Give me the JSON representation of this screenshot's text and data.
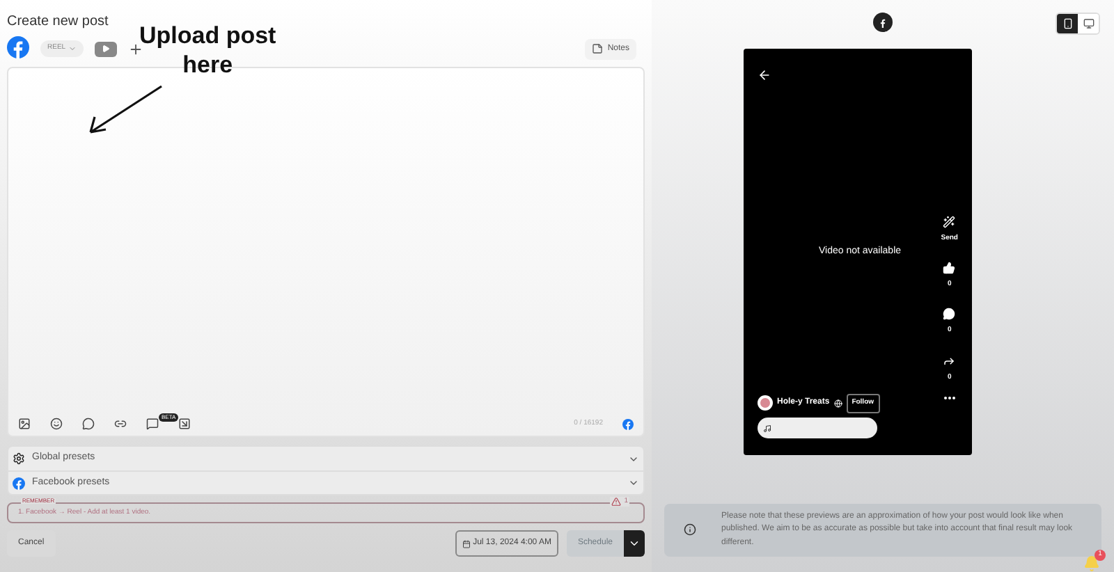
{
  "title": "Create new post",
  "composer": {
    "post_type": "REEL",
    "notes": "Notes",
    "char_count": "0 / 16192",
    "beta": "BETA"
  },
  "annotation": {
    "lines": [
      "Upload post",
      "here"
    ]
  },
  "presets": [
    {
      "kind": "global",
      "label": "Global presets"
    },
    {
      "kind": "facebook",
      "label": "Facebook presets"
    }
  ],
  "reminder": {
    "label": "REMEMBER",
    "message": "1. Facebook → Reel - Add at least 1 video.",
    "count": "1"
  },
  "footer": {
    "cancel": "Cancel",
    "date": "Jul 13, 2024 4:00 AM",
    "schedule": "Schedule"
  },
  "preview": {
    "devices": [
      {
        "kind": "mobile",
        "selected": true
      },
      {
        "kind": "desktop",
        "selected": false
      }
    ],
    "video_message": "Video not available",
    "send": "Send",
    "likes": "0",
    "comments": "0",
    "shares": "0",
    "page_name": "Hole-y Treats",
    "follow": "Follow",
    "note": "Please note that these previews are an approximation of how your post would look like when published. We aim to be as accurate as possible but take into account that final result may look different."
  },
  "notifications": {
    "count": "1"
  }
}
